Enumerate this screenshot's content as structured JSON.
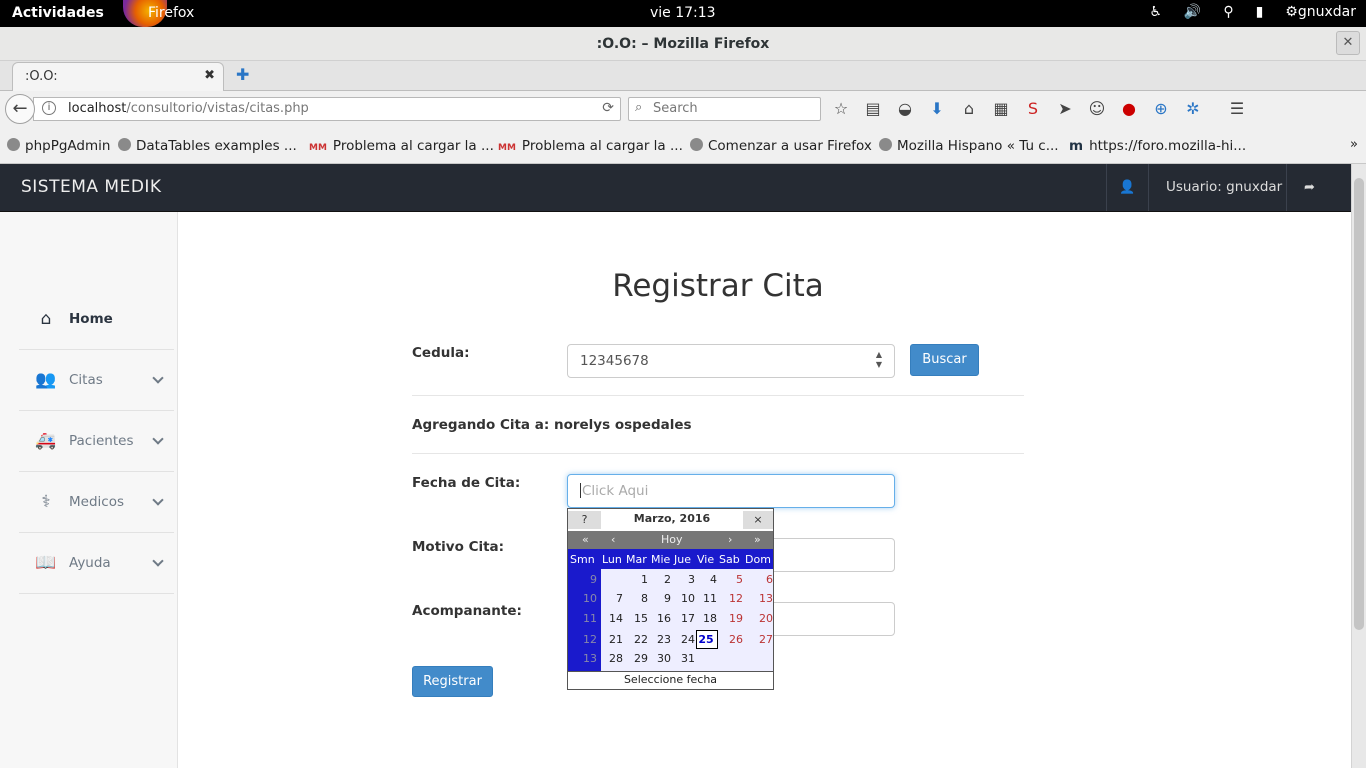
{
  "desktop": {
    "activities": "Actividades",
    "app_name": "Firefox",
    "clock": "vie 17:13",
    "user": "gnuxdar"
  },
  "window": {
    "title": ":O.O: – Mozilla Firefox",
    "tab_title": ":O.O:",
    "url_host": "localhost",
    "url_path": "/consultorio/vistas/citas.php",
    "search_placeholder": "Search"
  },
  "bookmarks": [
    "phpPgAdmin",
    "DataTables examples ...",
    "Problema al cargar la ...",
    "Problema al cargar la ...",
    "Comenzar a usar Firefox",
    "Mozilla Hispano « Tu c...",
    "https://foro.mozilla-hi..."
  ],
  "app": {
    "brand": "SISTEMA MEDIK",
    "user_label": "Usuario: gnuxdar"
  },
  "sidebar": {
    "items": [
      {
        "label": "Home",
        "icon": "home-icon"
      },
      {
        "label": "Citas",
        "icon": "users-icon"
      },
      {
        "label": "Pacientes",
        "icon": "ambulance-icon"
      },
      {
        "label": "Medicos",
        "icon": "doctor-icon"
      },
      {
        "label": "Ayuda",
        "icon": "book-icon"
      }
    ]
  },
  "form": {
    "title": "Registrar Cita",
    "cedula_label": "Cedula:",
    "cedula_value": "12345678",
    "buscar_label": "Buscar",
    "agregando": "Agregando Cita a: norelys ospedales",
    "fecha_label": "Fecha de Cita:",
    "fecha_placeholder": "Click Aqui",
    "motivo_label": "Motivo Cita:",
    "acompanante_label": "Acompanante:",
    "registrar_label": "Registrar"
  },
  "calendar": {
    "help": "?",
    "month_title": "Marzo, 2016",
    "close": "×",
    "prev_year": "«",
    "prev_month": "‹",
    "today": "Hoy",
    "next_month": "›",
    "next_year": "»",
    "day_headers": [
      "Smn",
      "Lun",
      "Mar",
      "Mie",
      "Jue",
      "Vie",
      "Sab",
      "Dom"
    ],
    "weeks": [
      {
        "num": "9",
        "days": [
          "",
          "1",
          "2",
          "3",
          "4",
          "5",
          "6"
        ]
      },
      {
        "num": "10",
        "days": [
          "7",
          "8",
          "9",
          "10",
          "11",
          "12",
          "13"
        ]
      },
      {
        "num": "11",
        "days": [
          "14",
          "15",
          "16",
          "17",
          "18",
          "19",
          "20"
        ]
      },
      {
        "num": "12",
        "days": [
          "21",
          "22",
          "23",
          "24",
          "25",
          "26",
          "27"
        ]
      },
      {
        "num": "13",
        "days": [
          "28",
          "29",
          "30",
          "31",
          "",
          "",
          ""
        ]
      }
    ],
    "selected_day": "25",
    "footer": "Seleccione fecha"
  }
}
